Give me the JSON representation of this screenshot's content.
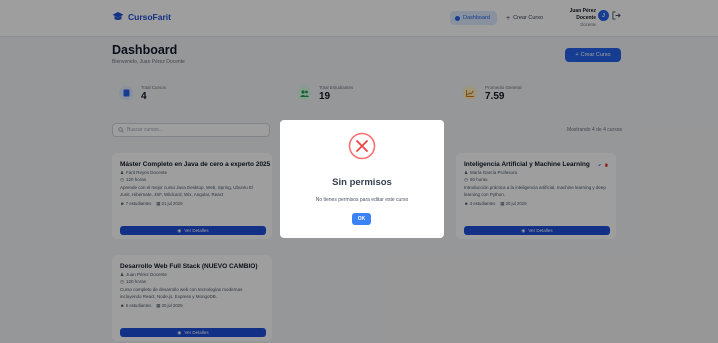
{
  "navbar": {
    "brand": "CursoFarit",
    "dashboard_label": "Dashboard",
    "create_course_label": "Crear Curso",
    "user_name": "Juan Pérez Docente",
    "user_role": "Docente",
    "avatar_initial": "J"
  },
  "header": {
    "title": "Dashboard",
    "subtitle": "Bienvenido, Juan Pérez Docente",
    "create_button": "Crear Curso"
  },
  "stats": [
    {
      "label": "Total Cursos",
      "value": "4"
    },
    {
      "label": "Total Estudiantes",
      "value": "19"
    },
    {
      "label": "Promedio General",
      "value": "7.59"
    }
  ],
  "search": {
    "placeholder": "Buscar cursos..."
  },
  "showing_text": "Mostrando 4 de 4 cursos",
  "courses": [
    {
      "title": "Máster Completo en Java de cero a experto 2025",
      "teacher": "Farit Reyes Docente",
      "hours": "120 horas",
      "description": "Aprende con el mejor curso Java Desktop, Web, Spring, Ubuntu El Junit, Hibernate, JSF, Wildcard, Wix, Angular, React",
      "students": "7 estudiantes",
      "date": "21 jul 2025",
      "button": "Ver Detalles"
    },
    {
      "title": "Inteligencia Artificial y Machine Learning",
      "teacher": "María García Profesora",
      "hours": "60 horas",
      "description": "Introducción práctica a la inteligencia artificial, machine learning y deep learning con Python.",
      "students": "4 estudiantes",
      "date": "20 jul 2025",
      "button": "Ver Detalles"
    },
    {
      "title": "Desarrollo Web Full Stack (NUEVO CAMBIO)",
      "teacher": "Juan Pérez Docente",
      "hours": "120 horas",
      "description": "Curso completo de desarrollo web con tecnologías modernas incluyendo React, Node.js, Express y MongoDB.",
      "students": "5 estudiantes",
      "date": "20 jul 2025",
      "button": "Ver Detalles"
    }
  ],
  "modal": {
    "title": "Sin permisos",
    "message": "No tienes permisos para editar este curso",
    "ok_button": "OK"
  },
  "colors": {
    "primary": "#2563eb",
    "error": "#ef4444",
    "overlay": "rgba(0,0,0,0.38)"
  }
}
